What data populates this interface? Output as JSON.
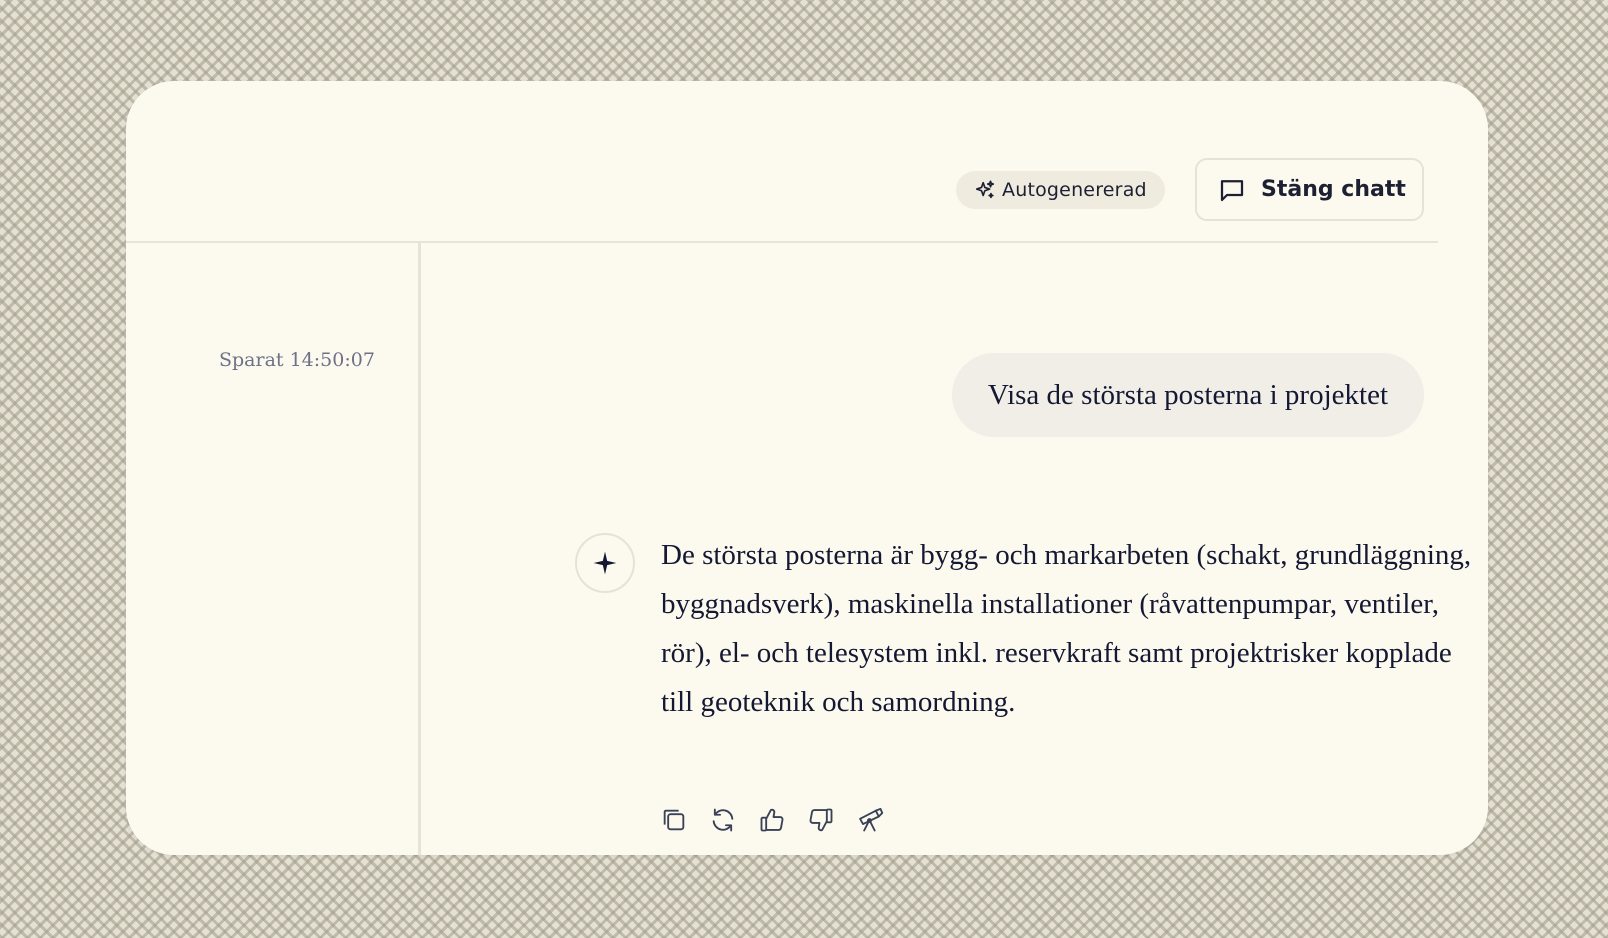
{
  "header": {
    "badge_label": "Autogenererad",
    "close_label": "Stäng chatt"
  },
  "sidebar": {
    "saved_status": "Sparat 14:50:07"
  },
  "chat": {
    "user_message": "Visa de största posterna i projektet",
    "assistant_message": "De största posterna är bygg- och markarbeten (schakt, grundläggning, byggnadsverk), maskinella installationer (råvattenpumpar, ventiler, rör), el- och telesystem inkl. reservkraft samt projektrisker kopplade till geoteknik och samordning."
  },
  "message_actions": [
    {
      "icon": "copy-icon"
    },
    {
      "icon": "regenerate-icon"
    },
    {
      "icon": "thumbs-up-icon"
    },
    {
      "icon": "thumbs-down-icon"
    },
    {
      "icon": "telescope-icon"
    }
  ],
  "colors": {
    "card_bg": "#fcf9ee",
    "text": "#141833",
    "muted": "#6e7187",
    "icon": "#3a4257"
  }
}
